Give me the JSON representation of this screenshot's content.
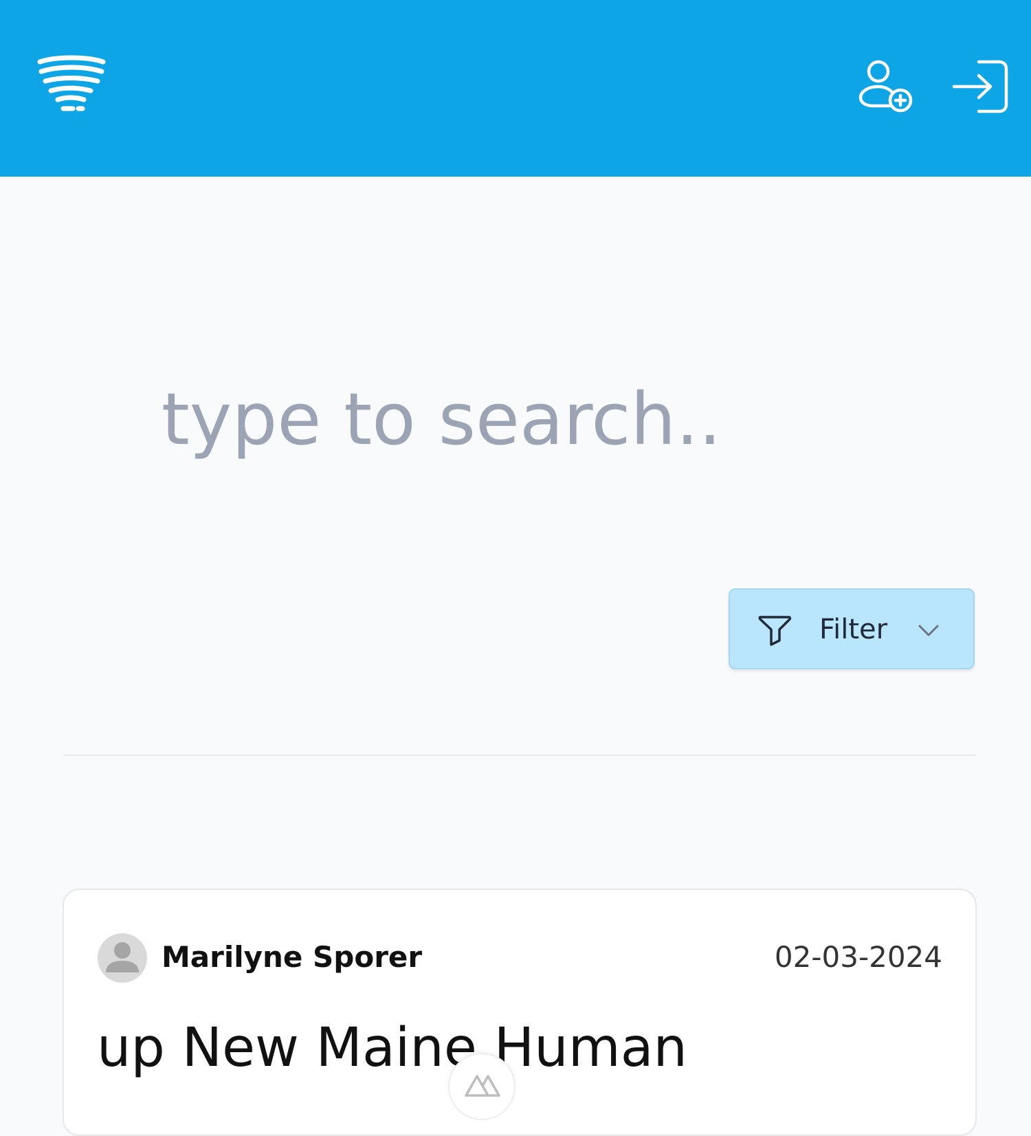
{
  "header": {
    "logo_icon": "tornado-icon",
    "signup_icon": "user-plus-icon",
    "login_icon": "login-arrow-icon",
    "background_color": "#0ea5e6"
  },
  "search": {
    "value": "",
    "placeholder": "type to search.."
  },
  "filter": {
    "label": "Filter",
    "icon": "funnel-icon",
    "chevron_icon": "chevron-down-icon",
    "background_color": "#bae6fd"
  },
  "posts": [
    {
      "author": "Marilyne Sporer",
      "date": "02-03-2024",
      "title": "up New Maine Human",
      "avatar_icon": "user-avatar-icon"
    }
  ],
  "floating_badge": {
    "icon": "nuxt-mountain-icon"
  }
}
